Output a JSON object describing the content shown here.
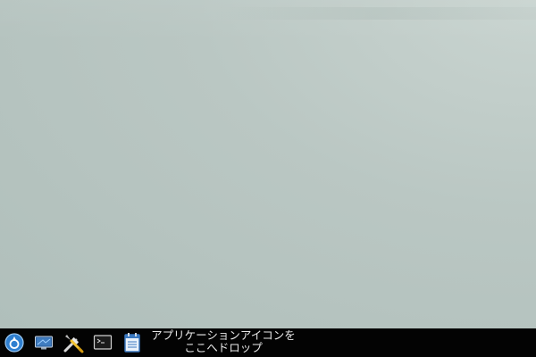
{
  "desktop": {
    "background_colors": [
      "#c9d4d0",
      "#bac7c3",
      "#b0bfbb"
    ]
  },
  "taskbar": {
    "background": "#030303",
    "launchers": [
      {
        "name": "start-menu",
        "icon": "app-menu-icon"
      },
      {
        "name": "file-manager",
        "icon": "monitor-icon"
      },
      {
        "name": "settings",
        "icon": "wrench-screwdriver-icon"
      },
      {
        "name": "terminal",
        "icon": "terminal-icon"
      },
      {
        "name": "notes",
        "icon": "notepad-icon"
      }
    ],
    "drop_hint_line1": "アプリケーションアイコンを",
    "drop_hint_line2": "ここへドロップ"
  }
}
